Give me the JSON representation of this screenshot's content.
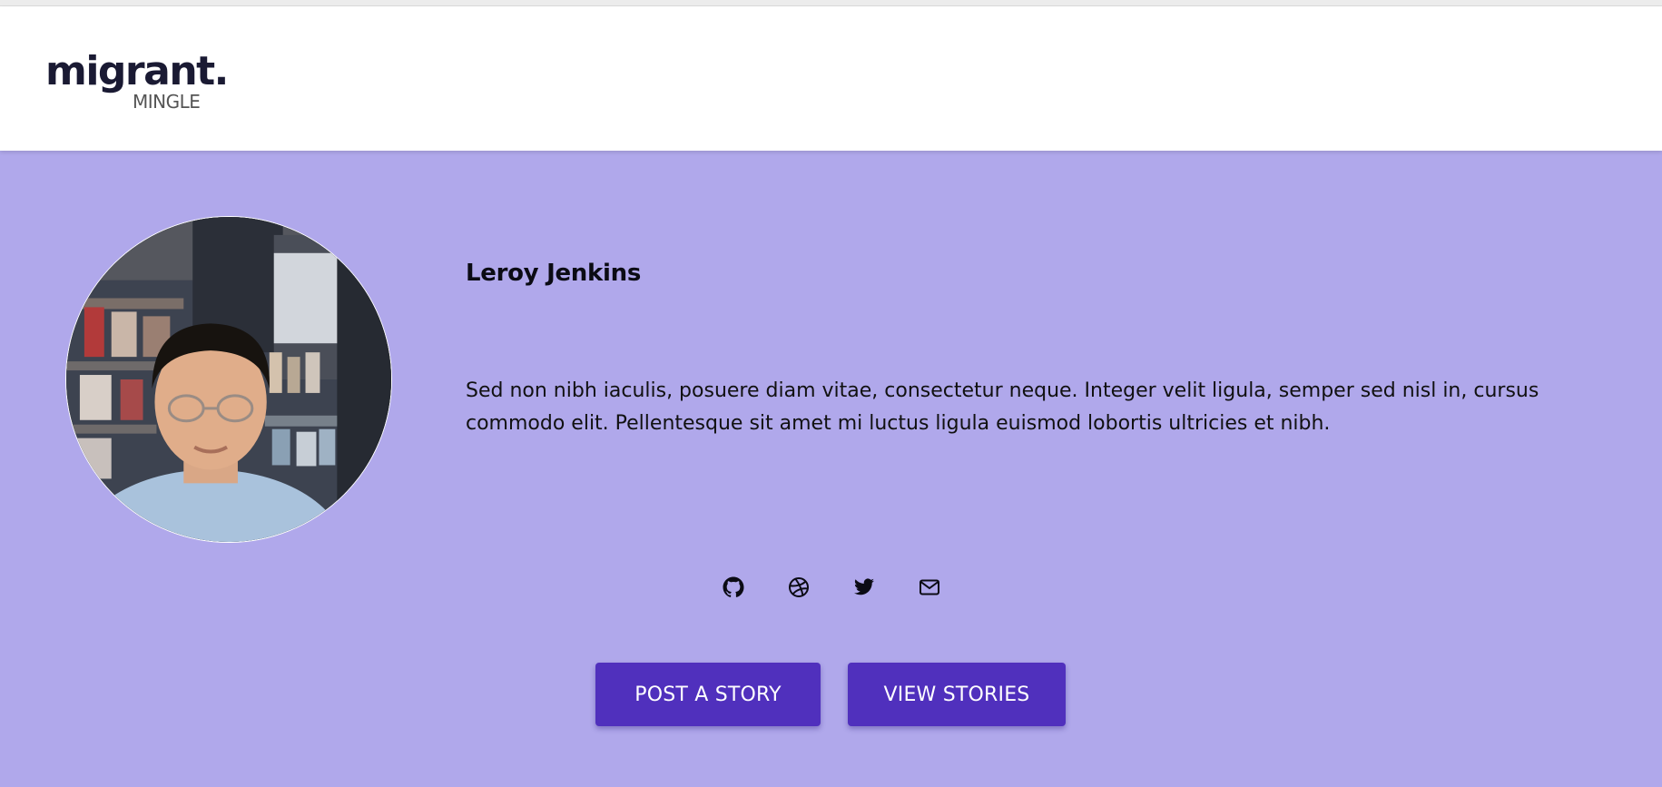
{
  "brand": {
    "name": "migrant.",
    "tagline": "MINGLE"
  },
  "profile": {
    "name": "Leroy Jenkins",
    "bio": "Sed non nibh iaculis, posuere diam vitae, consectetur neque. Integer velit ligula, semper sed nisl in, cursus commodo elit. Pellentesque sit amet mi luctus ligula euismod lobortis ultricies et nibh.",
    "avatar_icon": "user-photo"
  },
  "socials": [
    {
      "icon": "github-icon"
    },
    {
      "icon": "dribbble-icon"
    },
    {
      "icon": "twitter-icon"
    },
    {
      "icon": "mail-icon"
    }
  ],
  "actions": {
    "post_label": "POST A STORY",
    "view_label": "VIEW STORIES"
  },
  "colors": {
    "background": "#b0a8eb",
    "header": "#ffffff",
    "button": "#5030bd",
    "button_text": "#ffffff",
    "text": "#0b0b14"
  }
}
